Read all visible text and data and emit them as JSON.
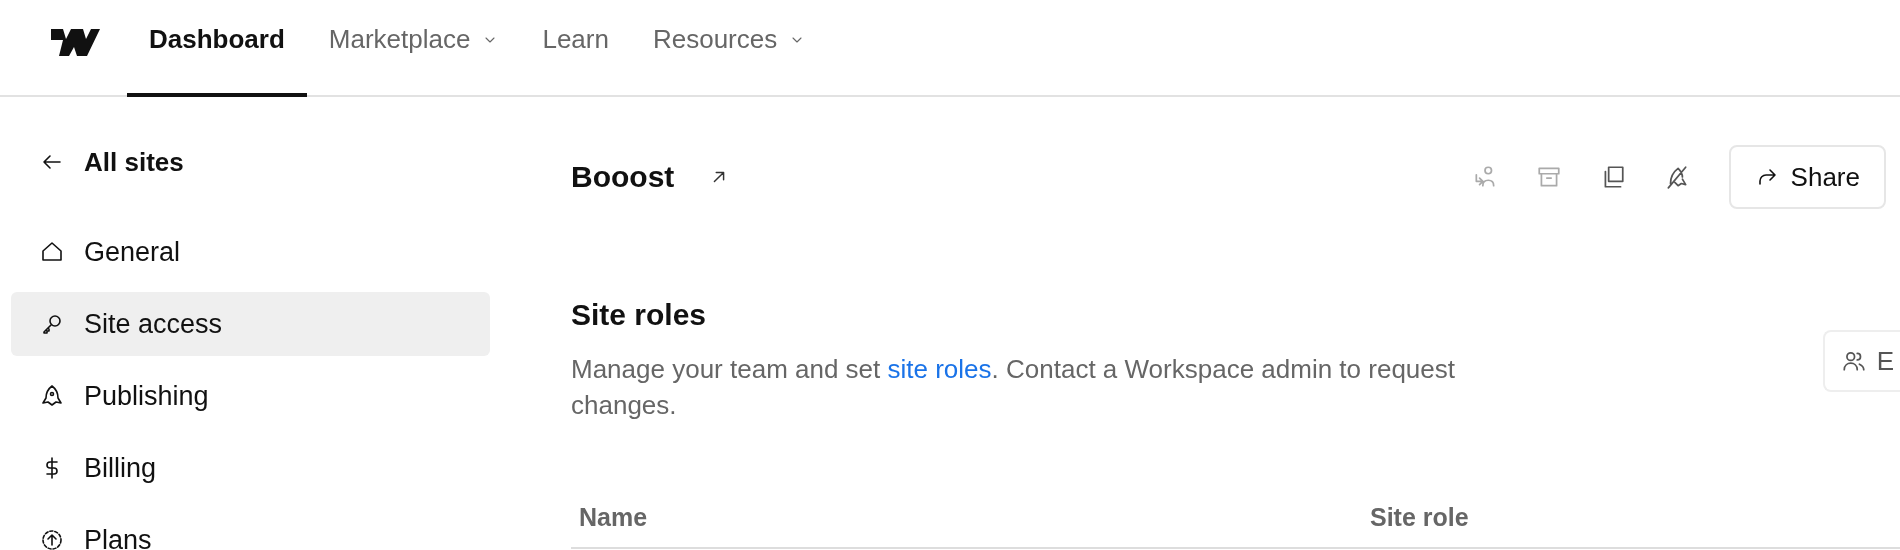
{
  "nav": {
    "tabs": [
      {
        "label": "Dashboard",
        "selected": true,
        "dropdown": false
      },
      {
        "label": "Marketplace",
        "selected": false,
        "dropdown": true
      },
      {
        "label": "Learn",
        "selected": false,
        "dropdown": false
      },
      {
        "label": "Resources",
        "selected": false,
        "dropdown": true
      }
    ]
  },
  "sidebar": {
    "back": {
      "label": "All sites"
    },
    "items": [
      {
        "kind": "home",
        "label": "General",
        "selected": false
      },
      {
        "kind": "key",
        "label": "Site access",
        "selected": true
      },
      {
        "kind": "rocket",
        "label": "Publishing",
        "selected": false
      },
      {
        "kind": "dollar",
        "label": "Billing",
        "selected": false
      },
      {
        "kind": "upgrade",
        "label": "Plans",
        "selected": false
      }
    ]
  },
  "site": {
    "title": "Booost",
    "actions": [
      {
        "kind": "transfer",
        "disabled": true
      },
      {
        "kind": "archive",
        "disabled": true
      },
      {
        "kind": "duplicate",
        "disabled": false
      },
      {
        "kind": "unpublish",
        "disabled": false
      }
    ],
    "share": {
      "label": "Share"
    }
  },
  "site_roles": {
    "heading": "Site roles",
    "description": "Manage your team and set ",
    "link": "site roles",
    "description_end": ". Contact a Workspace admin to request changes.",
    "side_button": {
      "label": "E"
    }
  },
  "table": {
    "columns": [
      "Name",
      "Site role"
    ]
  }
}
